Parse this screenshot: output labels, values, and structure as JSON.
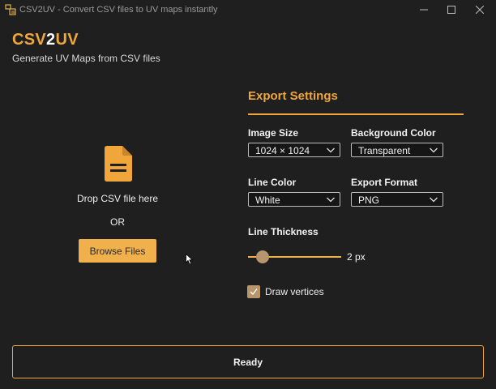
{
  "window": {
    "title": "CSV2UV - Convert CSV files to UV maps instantly",
    "controls": [
      "minimize-icon",
      "maximize-icon",
      "close-icon"
    ]
  },
  "header": {
    "brand_part1": "CSV",
    "brand_part2": "2",
    "brand_part3": "UV",
    "subtitle": "Generate UV Maps from CSV files"
  },
  "drop_zone": {
    "icon": "file-icon",
    "prompt": "Drop CSV file here",
    "or": "OR",
    "browse_label": "Browse Files"
  },
  "settings": {
    "title": "Export Settings",
    "image_size": {
      "label": "Image Size",
      "value": "1024 × 1024"
    },
    "background_color": {
      "label": "Background Color",
      "value": "Transparent"
    },
    "line_color": {
      "label": "Line Color",
      "value": "White"
    },
    "export_format": {
      "label": "Export Format",
      "value": "PNG"
    },
    "line_thickness": {
      "label": "Line Thickness",
      "value_text": "2 px",
      "value": 2
    },
    "draw_vertices": {
      "label": "Draw vertices",
      "checked": true
    }
  },
  "status": {
    "text": "Ready"
  },
  "colors": {
    "accent": "#f0a63a",
    "button": "#f0b04b",
    "background": "#1f1f1f",
    "thumb": "#b8956a"
  }
}
